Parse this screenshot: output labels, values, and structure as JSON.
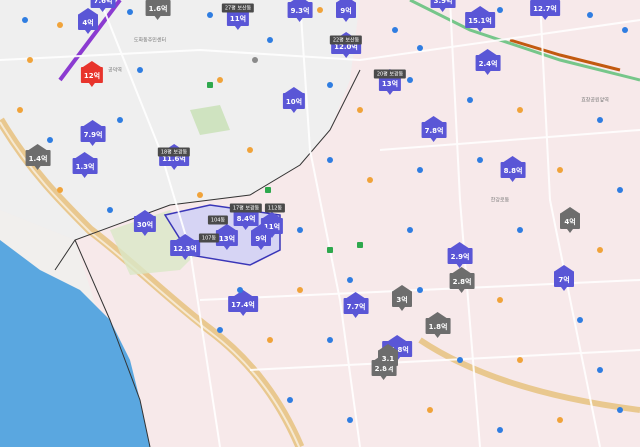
{
  "markers": [
    {
      "label": "4억",
      "type": "blue",
      "pos": "a"
    },
    {
      "label": "1.6억",
      "type": "gray",
      "pos": "b"
    },
    {
      "label": "7.6억",
      "type": "blue",
      "pos": "c"
    },
    {
      "label": "11억",
      "type": "blue",
      "pos": "d"
    },
    {
      "label": "9.3억",
      "type": "blue",
      "pos": "e"
    },
    {
      "label": "9억",
      "type": "blue",
      "pos": "f"
    },
    {
      "label": "3.9억",
      "type": "blue",
      "pos": "g"
    },
    {
      "label": "12.7억",
      "type": "blue",
      "pos": "h"
    },
    {
      "label": "15.1억",
      "type": "blue",
      "pos": "i"
    },
    {
      "label": "12억",
      "type": "red",
      "pos": "j"
    },
    {
      "label": "12.0억",
      "type": "blue",
      "pos": "k"
    },
    {
      "label": "13억",
      "type": "blue",
      "pos": "l"
    },
    {
      "label": "2.4억",
      "type": "blue",
      "pos": "m"
    },
    {
      "label": "10억",
      "type": "blue",
      "pos": "n"
    },
    {
      "label": "7.9억",
      "type": "blue",
      "pos": "o"
    },
    {
      "label": "7.8억",
      "type": "blue",
      "pos": "p"
    },
    {
      "label": "11.6억",
      "type": "blue",
      "pos": "q"
    },
    {
      "label": "1.3억",
      "type": "blue",
      "pos": "r"
    },
    {
      "label": "1.4억",
      "type": "gray",
      "pos": "s"
    },
    {
      "label": "8.8억",
      "type": "blue",
      "pos": "t"
    },
    {
      "label": "30억",
      "type": "blue",
      "pos": "u"
    },
    {
      "label": "12.3억",
      "type": "blue",
      "pos": "v"
    },
    {
      "label": "2.9억",
      "type": "blue",
      "pos": "w"
    },
    {
      "label": "2.8억",
      "type": "gray",
      "pos": "x"
    },
    {
      "label": "17.4억",
      "type": "blue",
      "pos": "y"
    },
    {
      "label": "7.7억",
      "type": "blue",
      "pos": "z"
    },
    {
      "label": "3억",
      "type": "gray",
      "pos": "aa"
    },
    {
      "label": "1.8억",
      "type": "gray",
      "pos": "ab"
    },
    {
      "label": "7억",
      "type": "blue",
      "pos": "ac"
    },
    {
      "label": "14.8억",
      "type": "blue",
      "pos": "ad"
    },
    {
      "label": "2.8억",
      "type": "gray",
      "pos": "ae"
    },
    {
      "label": "3.1",
      "type": "gray",
      "pos": "af"
    },
    {
      "label": "4억",
      "type": "gray",
      "pos": "ag"
    },
    {
      "label": "8.4억",
      "type": "blue",
      "pos": "ah"
    },
    {
      "label": "11억",
      "type": "blue",
      "pos": "ai"
    },
    {
      "label": "13억",
      "type": "blue",
      "pos": "aj"
    },
    {
      "label": "9억",
      "type": "blue",
      "pos": "ak"
    }
  ],
  "labels": [
    {
      "text": "27평 보산동",
      "pos": "l1"
    },
    {
      "text": "22평 보산동",
      "pos": "l2"
    },
    {
      "text": "20평 보광동",
      "pos": "l3"
    },
    {
      "text": "18평 보광동",
      "pos": "l4"
    },
    {
      "text": "17평 보광동",
      "pos": "l5"
    },
    {
      "text": "104동",
      "pos": "l6"
    },
    {
      "text": "112동",
      "pos": "l7"
    },
    {
      "text": "107동",
      "pos": "l8"
    }
  ],
  "places": [
    {
      "text": "도화동주민센터",
      "pos": "p1"
    },
    {
      "text": "공덕역",
      "pos": "p2"
    },
    {
      "text": "효창공원앞역",
      "pos": "p3"
    },
    {
      "text": "한강로동",
      "pos": "p4"
    }
  ]
}
